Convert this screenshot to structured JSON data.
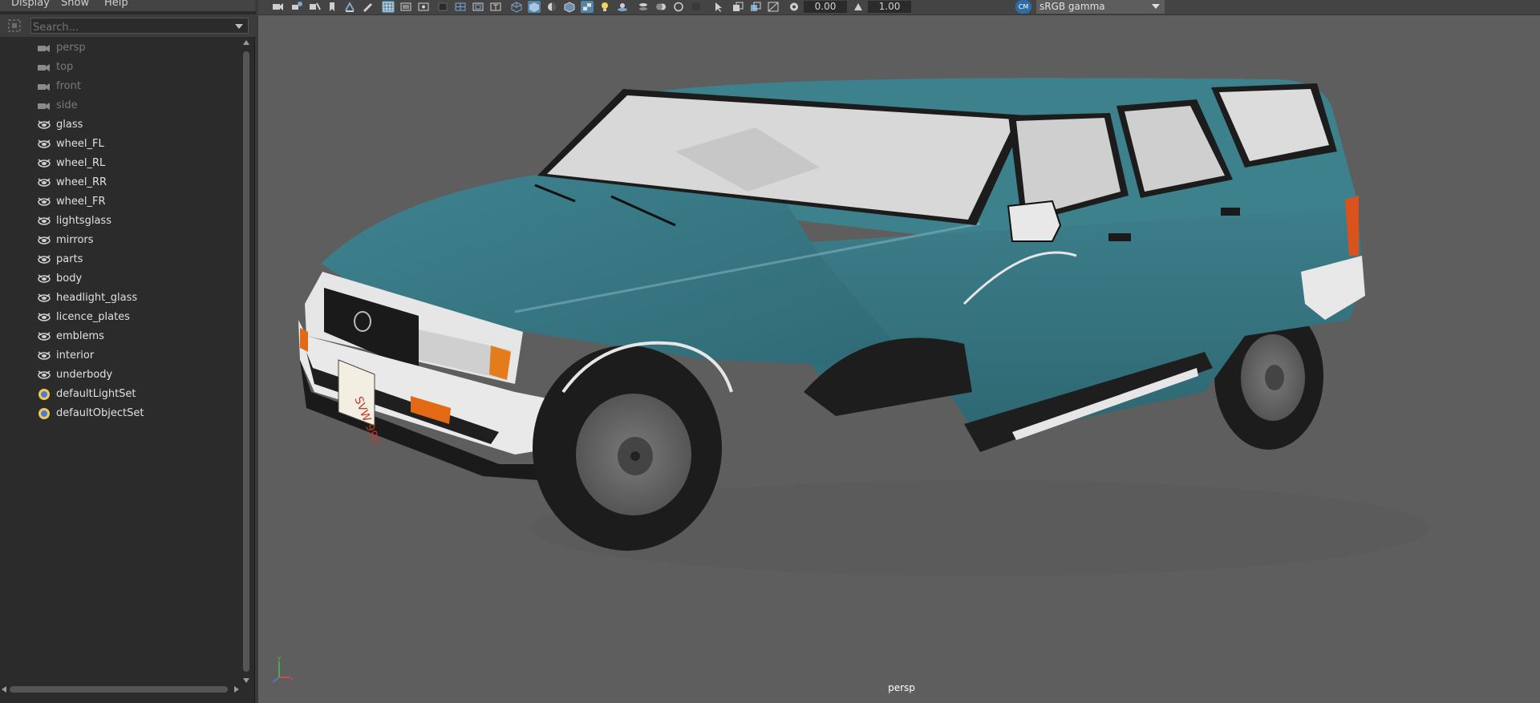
{
  "menu": {
    "display": "Display",
    "show": "Show",
    "help": "Help"
  },
  "search": {
    "placeholder": "Search..."
  },
  "outliner": {
    "items": [
      {
        "label": "persp",
        "icon": "camera-icon",
        "dim": true
      },
      {
        "label": "top",
        "icon": "camera-icon",
        "dim": true
      },
      {
        "label": "front",
        "icon": "camera-icon",
        "dim": true
      },
      {
        "label": "side",
        "icon": "camera-icon",
        "dim": true
      },
      {
        "label": "glass",
        "icon": "group-icon"
      },
      {
        "label": "wheel_FL",
        "icon": "group-icon"
      },
      {
        "label": "wheel_RL",
        "icon": "group-icon"
      },
      {
        "label": "wheel_RR",
        "icon": "group-icon"
      },
      {
        "label": "wheel_FR",
        "icon": "group-icon"
      },
      {
        "label": "lightsglass",
        "icon": "group-icon"
      },
      {
        "label": "mirrors",
        "icon": "group-icon"
      },
      {
        "label": "parts",
        "icon": "group-icon"
      },
      {
        "label": "body",
        "icon": "group-icon"
      },
      {
        "label": "headlight_glass",
        "icon": "group-icon"
      },
      {
        "label": "licence_plates",
        "icon": "group-icon"
      },
      {
        "label": "emblems",
        "icon": "group-icon"
      },
      {
        "label": "interior",
        "icon": "group-icon"
      },
      {
        "label": "underbody",
        "icon": "group-icon"
      },
      {
        "label": "defaultLightSet",
        "icon": "set-icon"
      },
      {
        "label": "defaultObjectSet",
        "icon": "set-icon"
      }
    ]
  },
  "toolbar": {
    "exposure": "0.00",
    "gamma": "1.00",
    "colorspace": "sRGB gamma",
    "colorspace_badge": "CM"
  },
  "viewport": {
    "camera": "persp",
    "plate": "SVW 995"
  },
  "colors": {
    "body_teal": "#3a7a86",
    "viewport_bg": "#5e5e5e",
    "outliner_bg": "#2b2b2b",
    "highlight": "#5285a6"
  }
}
